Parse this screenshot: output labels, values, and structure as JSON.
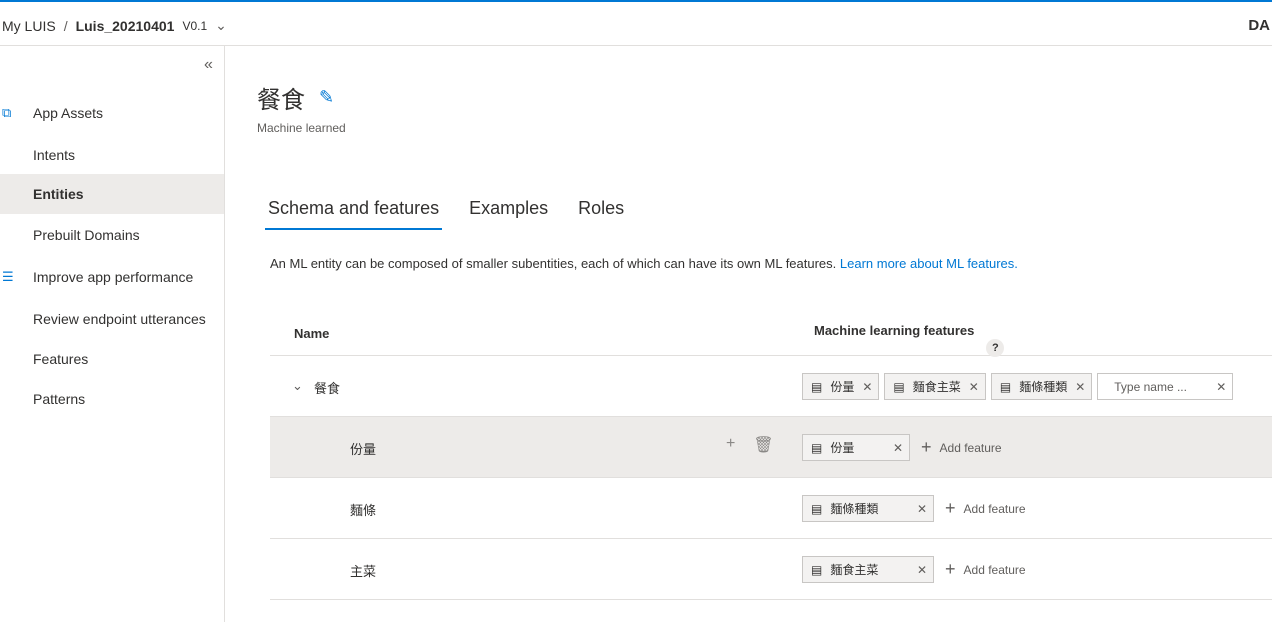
{
  "header": {
    "root": "My LUIS",
    "separator": "/",
    "app": "Luis_20210401",
    "version": "V0.1",
    "user": "DA"
  },
  "sidebar": {
    "items": [
      {
        "label": "App Assets",
        "icon": "app-assets-icon"
      },
      {
        "label": "Intents"
      },
      {
        "label": "Entities",
        "active": true
      },
      {
        "label": "Prebuilt Domains"
      },
      {
        "label": "Improve app performance",
        "icon": "sliders-icon"
      },
      {
        "label": "Review endpoint utterances"
      },
      {
        "label": "Features"
      },
      {
        "label": "Patterns"
      }
    ]
  },
  "entity": {
    "title": "餐食",
    "type": "Machine learned"
  },
  "tabs": [
    "Schema and features",
    "Examples",
    "Roles"
  ],
  "description": {
    "text": "An ML entity can be composed of smaller subentities, each of which can have its own ML features. ",
    "link": "Learn more about ML features."
  },
  "table": {
    "col_name": "Name",
    "col_features": "Machine learning features",
    "help": "?",
    "root": {
      "name": "餐食",
      "features": [
        "份量",
        "麵食主菜",
        "麵條種類"
      ],
      "input_placeholder": "Type name ..."
    },
    "children": [
      {
        "name": "份量",
        "features": [
          "份量"
        ]
      },
      {
        "name": "麵條",
        "features": [
          "麵條種類"
        ]
      },
      {
        "name": "主菜",
        "features": [
          "麵食主菜"
        ]
      }
    ],
    "add_label": "Add feature"
  },
  "colors": {
    "accent": "#0078d4",
    "selected_row": "#edebe9"
  }
}
